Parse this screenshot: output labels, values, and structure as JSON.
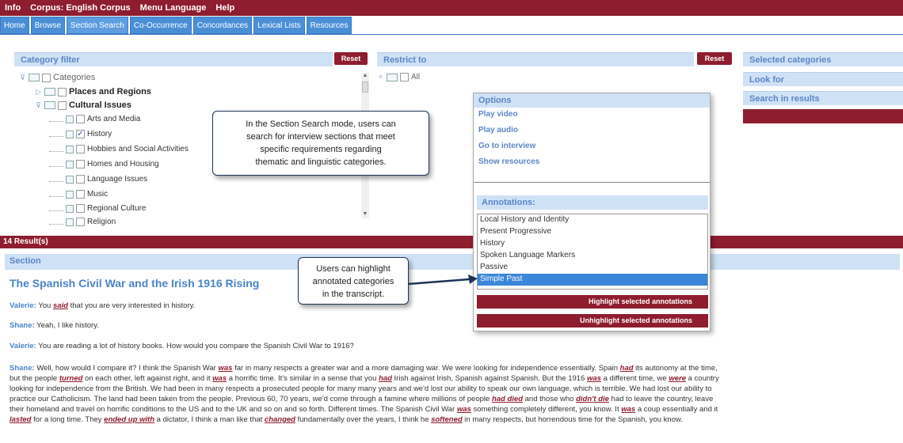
{
  "menu": [
    "Info",
    "Corpus: English Corpus",
    "Menu Language",
    "Help"
  ],
  "tabs": [
    "Home",
    "Browse",
    "Section Search",
    "Co-Occurrence",
    "Concordances",
    "Lexical Lists",
    "Resources"
  ],
  "category_filter": {
    "title": "Category filter",
    "reset": "Reset",
    "root": "Categories",
    "items": [
      "Places and Regions",
      "Cultural Issues"
    ],
    "subitems": [
      "Arts and Media",
      "History",
      "Hobbies and Social Activities",
      "Homes and Housing",
      "Language Issues",
      "Music",
      "Regional Culture",
      "Religion"
    ]
  },
  "restrict": {
    "title": "Restrict to",
    "reset": "Reset",
    "all": "All"
  },
  "right_panel": {
    "selected": "Selected categories",
    "look_for": "Look for",
    "search_in": "Search in results"
  },
  "callout1": {
    "l1": "In the Section Search mode, users can",
    "l2": "search for interview sections that meet",
    "l3": "specific requirements regarding",
    "l4": "thematic and linguistic categories."
  },
  "callout2": {
    "l1": "Users can highlight",
    "l2": "annotated categories",
    "l3": "in the transcript."
  },
  "options": {
    "title": "Options",
    "items": [
      "Play video",
      "Play audio",
      "Go to interview",
      "Show resources"
    ],
    "annotations_title": "Annotations:",
    "annotations": [
      "Local History and Identity",
      "Present Progressive",
      "History",
      "Spoken Language Markers",
      "Passive",
      "Simple Past"
    ],
    "highlight_btn": "Highlight selected annotations",
    "unhighlight_btn": "Unhighlight selected annotations"
  },
  "results": {
    "count": "14 Result(s)",
    "section": "Section",
    "title": "The Spanish Civil War and the Irish 1916 Rising"
  },
  "transcript": {
    "v1_speaker": "Valerie:",
    "v1_a": " You ",
    "v1_hl": "said",
    "v1_b": " that you are very interested in history.",
    "s1_speaker": "Shane:",
    "s1_text": " Yeah, I like history.",
    "v2_speaker": "Valerie:",
    "v2_text": " You are reading a lot of history books. How would you compare the Spanish Civil War to 1916?",
    "s2_speaker": "Shane:",
    "p1": " Well, how would I compare it? I think the Spanish War ",
    "h1": "was",
    "p2": " far in many respects a greater war and a more damaging war. We were looking for independence essentially. Spain ",
    "h2": "had",
    "p3": " its autonomy at the time,",
    "p4": "but the people ",
    "h3": "turned",
    "p5": " on each other, left against right, and it ",
    "h4": "was",
    "p6": " a horrific time. It's similar in a sense that you ",
    "h5": "had",
    "p7": " Irish against Irish, Spanish against Spanish. But the 1916 ",
    "h6": "was",
    "p8": " a different time, we ",
    "h7": "were",
    "p9": " a country",
    "p10": "looking for independence from the British. We had been in many respects a prosecuted people for many many years and we'd lost our ability to speak our own language, which is terrible. We had lost our ability to",
    "p11": "practice our Catholicism. The land had been taken from the people. Previous 60, 70 years, we'd come through a famine where millions of people ",
    "h8": "had died",
    "p12": " and those who ",
    "h9": "didn't die",
    "p13": " had to leave the country, leave",
    "p14": "their homeland and travel on horrific conditions to the US and to the UK and so on and so forth. Different times. The Spanish Civil War ",
    "h10": "was",
    "p15": " something completely different, you know. It ",
    "h11": "was",
    "p16": " a coup essentially and it",
    "h12": "lasted",
    "p17": " for a long time. They ",
    "h13": "ended up with",
    "p18": " a dictator, I think a man like that ",
    "h14": "changed",
    "p19": " fundamentally over the years, I think he ",
    "h15": "softened",
    "p20": " in many respects, but horrendous time for the Spanish, you know."
  }
}
